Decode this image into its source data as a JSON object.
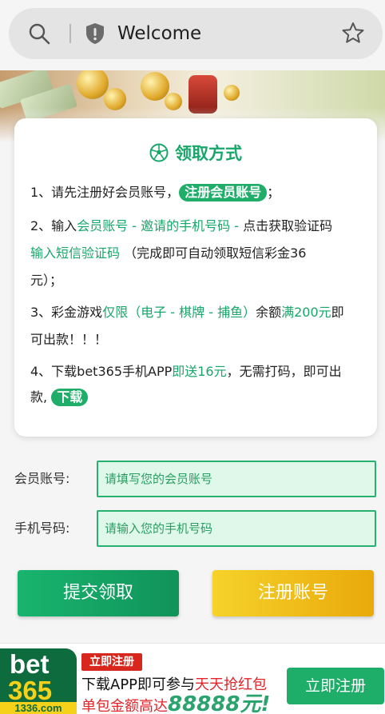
{
  "browser": {
    "title": "Welcome",
    "search_icon": "search-icon",
    "shield_icon": "shield-icon",
    "star_icon": "star-icon"
  },
  "card": {
    "title": "领取方式",
    "title_icon": "soccer-ball-icon",
    "step1": {
      "prefix": "1、请先注册好会员账号，",
      "pill": "注册会员账号",
      "suffix": "；"
    },
    "step2": {
      "prefix": "2、输入",
      "g1": "会员账号 - 邀请的手机号码 -",
      "mid": " 点击获取验证码",
      "g2": "输入短信验证码",
      "rest": "（完成即可自动领取短信彩金36",
      "end": "元）；"
    },
    "step3": {
      "prefix": "3、彩金游戏",
      "g1": "仅限（电子 - 棋牌 - 捕鱼）",
      "mid": "余额",
      "g2": "满200元",
      "suffix": "即",
      "line2": "可出款！！！"
    },
    "step4": {
      "prefix": "4、下载bet365手机APP",
      "g1": "即送16元",
      "suffix": "，无需打码，即可出",
      "line2": "款,",
      "pill": "下载"
    }
  },
  "form": {
    "account_label": "会员账号:",
    "account_placeholder": "请填写您的会员账号",
    "phone_label": "手机号码:",
    "phone_placeholder": "请输入您的手机号码",
    "submit_label": "提交领取",
    "register_label": "注册账号"
  },
  "ad": {
    "logo_line1": "bet",
    "logo_line2": "365",
    "logo_domain": "1336.com",
    "badge": "立即注册",
    "line1_a": "下载APP即可参与",
    "line1_b": "天天抢红包",
    "line2_a": "单包金额高达",
    "line2_big": "88888元!",
    "cta": "立即注册"
  },
  "colors": {
    "accent_green": "#18a66a",
    "button_yellow": "#f0be1a",
    "ad_red": "#e0262b"
  }
}
